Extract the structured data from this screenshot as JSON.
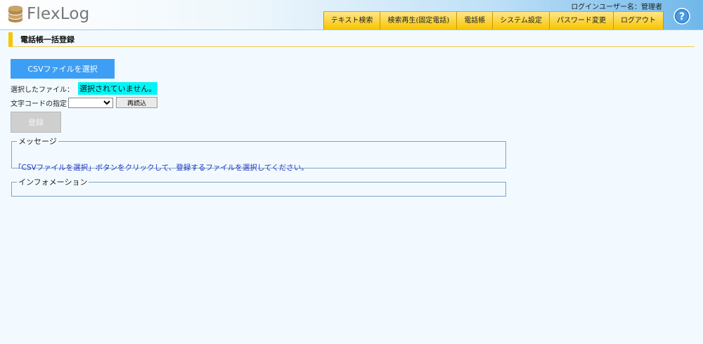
{
  "header": {
    "logo_text": "FlexLog",
    "login_user": "ログインユーザー名：管理者",
    "nav": [
      "テキスト検索",
      "検索再生(固定電話)",
      "電話帳",
      "システム設定",
      "パスワード変更",
      "ログアウト"
    ],
    "help_icon": "help-question-icon"
  },
  "page": {
    "title": "電話帳一括登録"
  },
  "form": {
    "csv_button_label": "CSVファイルを選択",
    "selected_file_label": "選択したファイル：",
    "selected_file_value": "選択されていません。",
    "encoding_label": "文字コードの指定",
    "encoding_value": "",
    "reload_label": "再読込",
    "register_label": "登録"
  },
  "message": {
    "legend": "メッセージ",
    "text": "「CSVファイルを選択」ボタンをクリックして、登録するファイルを選択してください。"
  },
  "information": {
    "legend": "インフォメーション"
  },
  "colors": {
    "primary_button": "#3d9ef5",
    "nav_yellow": "#f7c500",
    "highlight_cyan": "#00f5f5",
    "message_text": "#1f34c8"
  }
}
